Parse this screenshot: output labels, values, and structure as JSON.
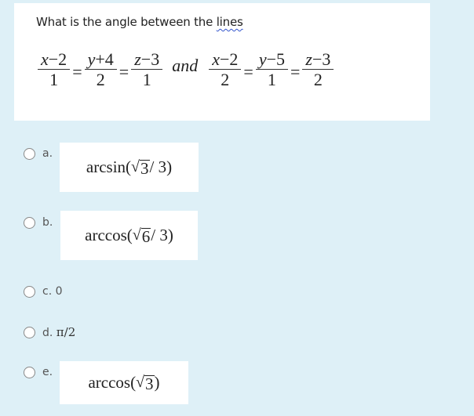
{
  "question": {
    "text_before": "What is the angle between the ",
    "text_flagged": "lines",
    "equation": {
      "line1": [
        {
          "num_var": "x",
          "num_rest": "−2",
          "den": "1"
        },
        {
          "num_var": "y",
          "num_rest": "+4",
          "den": "2"
        },
        {
          "num_var": "z",
          "num_rest": "−3",
          "den": "1"
        }
      ],
      "connector": "and",
      "line2": [
        {
          "num_var": "x",
          "num_rest": "−2",
          "den": "2"
        },
        {
          "num_var": "y",
          "num_rest": "−5",
          "den": "1"
        },
        {
          "num_var": "z",
          "num_rest": "−3",
          "den": "2"
        }
      ],
      "equals": "="
    }
  },
  "options": [
    {
      "letter": "a.",
      "func": "arcsin(",
      "radical": "√",
      "radicand": "3",
      "tail": " / 3)",
      "selected": false
    },
    {
      "letter": "b.",
      "func": "arccos(",
      "radical": "√",
      "radicand": "6",
      "tail": " / 3)",
      "selected": false
    },
    {
      "letter": "c.",
      "text": "0",
      "selected": false
    },
    {
      "letter": "d.",
      "text": "π/2",
      "selected": false
    },
    {
      "letter": "e.",
      "func": "arccos(",
      "radical": "√",
      "radicand": "3",
      "tail": ")",
      "selected": false
    }
  ]
}
